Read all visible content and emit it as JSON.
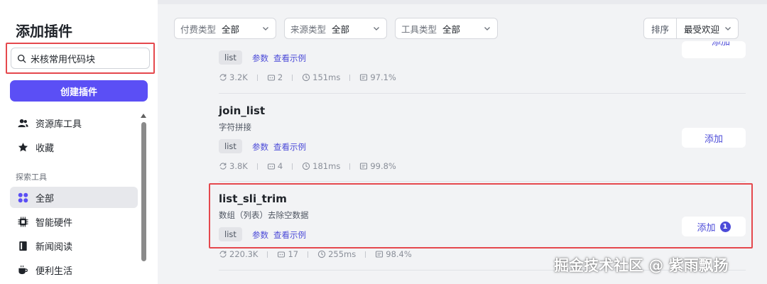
{
  "sidebar": {
    "title": "添加插件",
    "search_value": "米核常用代码块",
    "create_label": "创建插件",
    "items_top": [
      {
        "label": "资源库工具",
        "icon": "users-icon"
      },
      {
        "label": "收藏",
        "icon": "star-icon"
      }
    ],
    "section_label": "探索工具",
    "items_explore": [
      {
        "label": "全部",
        "icon": "grid-icon"
      },
      {
        "label": "智能硬件",
        "icon": "chip-icon"
      },
      {
        "label": "新闻阅读",
        "icon": "book-icon"
      },
      {
        "label": "便利生活",
        "icon": "cup-icon"
      }
    ]
  },
  "filters": {
    "pay": {
      "label": "付费类型",
      "value": "全部"
    },
    "source": {
      "label": "来源类型",
      "value": "全部"
    },
    "tool": {
      "label": "工具类型",
      "value": "全部"
    },
    "sort": {
      "label": "排序",
      "value": "最受欢迎"
    }
  },
  "cards": [
    {
      "name": "",
      "desc": "",
      "tag": "list",
      "params": "参数",
      "example": "查看示例",
      "stats": {
        "uses": "3.2K",
        "bots": "2",
        "latency": "151ms",
        "success": "97.1%"
      },
      "add_label": "添加"
    },
    {
      "name": "join_list",
      "desc": "字符拼接",
      "tag": "list",
      "params": "参数",
      "example": "查看示例",
      "stats": {
        "uses": "3.8K",
        "bots": "4",
        "latency": "181ms",
        "success": "99.8%"
      },
      "add_label": "添加"
    },
    {
      "name": "list_sli_trim",
      "desc": "数组（列表）去除空数据",
      "tag": "list",
      "params": "参数",
      "example": "查看示例",
      "stats": {
        "uses": "220.3K",
        "bots": "17",
        "latency": "255ms",
        "success": "98.4%"
      },
      "add_label": "添加",
      "badge": "1"
    }
  ],
  "watermark": "掘金技术社区 @ 紫雨飘扬",
  "colors": {
    "accent": "#5b4ff5",
    "link": "#4c4bd8",
    "highlight": "#e5484d"
  }
}
